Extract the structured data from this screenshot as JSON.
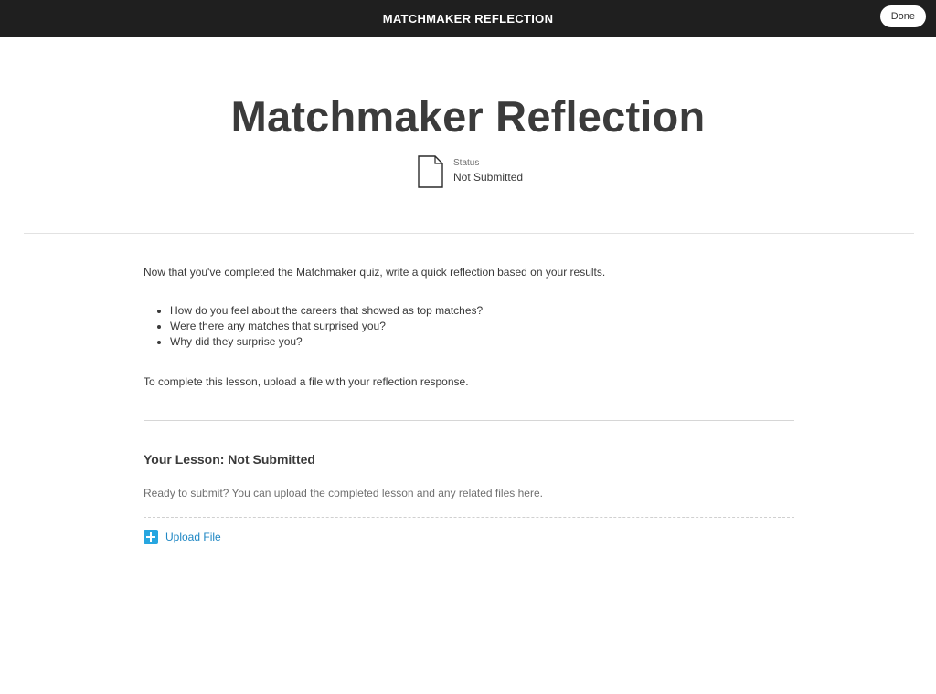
{
  "header": {
    "title": "MATCHMAKER REFLECTION",
    "done_label": "Done"
  },
  "page": {
    "title": "Matchmaker Reflection",
    "status_label": "Status",
    "status_value": "Not Submitted"
  },
  "content": {
    "intro": "Now that you've completed the Matchmaker quiz, write a quick reflection based on your results.",
    "bullets": [
      "How do you feel about the careers that showed as top matches?",
      "Were there any matches that surprised you?",
      "Why did they surprise you?"
    ],
    "completion_note": "To complete this lesson, upload a file with your reflection response."
  },
  "lesson": {
    "heading": "Your Lesson: Not Submitted",
    "description": "Ready to submit? You can upload the completed lesson and any related files here.",
    "upload_label": "Upload File"
  },
  "icons": {
    "status": "document-icon",
    "upload": "plus-icon"
  },
  "colors": {
    "topbar_bg": "#1f1f1f",
    "link_blue": "#1f87c4",
    "upload_icon_blue": "#27a6e0"
  }
}
